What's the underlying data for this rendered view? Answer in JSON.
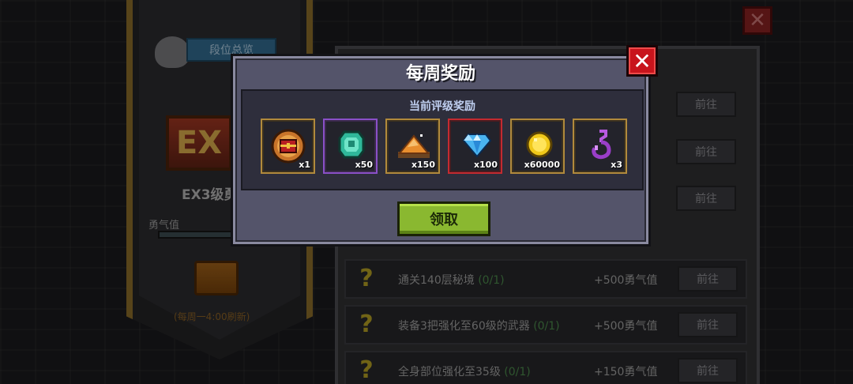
{
  "background": {
    "rank_overview_label": "段位总览",
    "rank_badge_text": "EX",
    "rank_name": "EX3级勇",
    "courage_label": "勇气值",
    "refresh_note": "(每周一4:00刷新)",
    "close_symbol": "✕",
    "goto_label": "前往",
    "tasks": [
      {
        "text": "通关140层秘境",
        "progress": "(0/1)",
        "reward": "+500勇气值"
      },
      {
        "text": "装备3把强化至60级的武器",
        "progress": "(0/1)",
        "reward": "+500勇气值"
      },
      {
        "text": "全身部位强化至35级",
        "progress": "(0/1)",
        "reward": "+150勇气值"
      }
    ]
  },
  "modal": {
    "title": "每周奖励",
    "close_symbol": "✕",
    "rewards_heading": "当前评级奖励",
    "claim_label": "领取",
    "rewards": [
      {
        "icon": "treasure-chest-token-icon",
        "quantity": "x1",
        "frame": "gold"
      },
      {
        "icon": "teal-gem-icon",
        "quantity": "x50",
        "frame": "purple"
      },
      {
        "icon": "sand-pile-icon",
        "quantity": "x150",
        "frame": "gold"
      },
      {
        "icon": "blue-diamond-icon",
        "quantity": "x100",
        "frame": "red"
      },
      {
        "icon": "gold-coin-icon",
        "quantity": "x60000",
        "frame": "gold"
      },
      {
        "icon": "purple-fish-hook-icon",
        "quantity": "x3",
        "frame": "gold"
      }
    ]
  }
}
